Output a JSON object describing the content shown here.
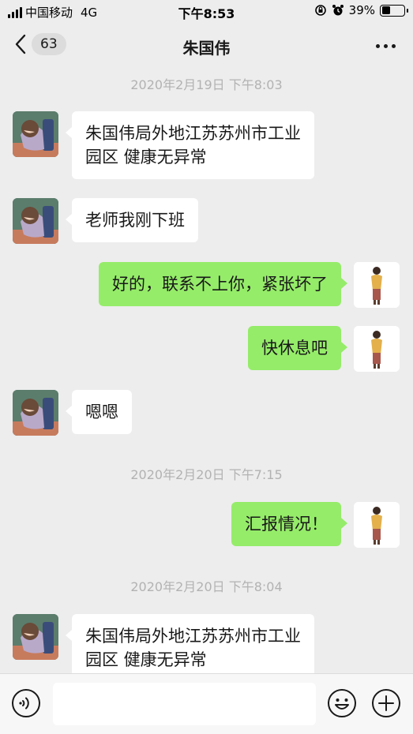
{
  "status_bar": {
    "carrier": "中国移动",
    "network": "4G",
    "time": "下午8:53",
    "battery_percent": "39%",
    "battery_level": 0.39
  },
  "header": {
    "back_count": "63",
    "title": "朱国伟",
    "more_icon": "more-dots-icon"
  },
  "messages": [
    {
      "type": "timestamp",
      "text": "2020年2月19日 下午8:03"
    },
    {
      "type": "received",
      "lines": [
        "朱国伟局外地江苏苏州市工业",
        "园区 健康无异常"
      ]
    },
    {
      "type": "received",
      "lines": [
        "老师我刚下班"
      ]
    },
    {
      "type": "sent",
      "lines": [
        "好的，联系不上你，紧张坏了"
      ]
    },
    {
      "type": "sent",
      "lines": [
        "快休息吧"
      ]
    },
    {
      "type": "received",
      "lines": [
        "嗯嗯"
      ]
    },
    {
      "type": "timestamp",
      "text": "2020年2月20日 下午7:15"
    },
    {
      "type": "sent",
      "lines": [
        "汇报情况！"
      ]
    },
    {
      "type": "timestamp",
      "text": "2020年2月20日 下午8:04"
    },
    {
      "type": "received",
      "lines": [
        "朱国伟局外地江苏苏州市工业",
        "园区 健康无异常"
      ]
    }
  ],
  "input_bar": {
    "input_value": "",
    "icons": [
      "voice-icon",
      "emoji-icon",
      "plus-icon"
    ]
  },
  "colors": {
    "background": "#ededed",
    "sent_bubble": "#95ec69",
    "received_bubble": "#ffffff",
    "timestamp": "#b2b2b2"
  }
}
